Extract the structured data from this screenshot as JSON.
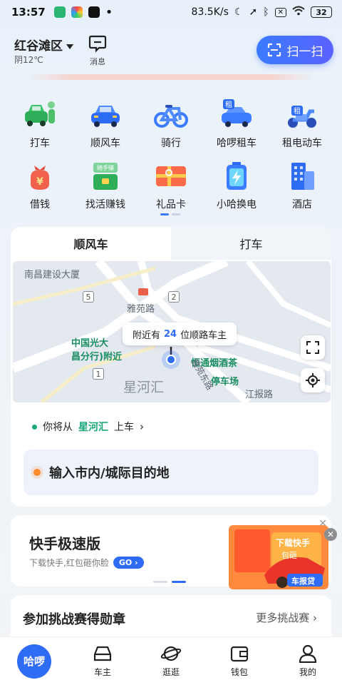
{
  "status_bar": {
    "time": "13:57",
    "net_speed": "83.5K/s",
    "battery": "32"
  },
  "header": {
    "location": "红谷滩区",
    "weather": "阴12℃",
    "message_label": "消息",
    "scan_label": "扫一扫"
  },
  "services_row1": [
    {
      "label": "打车",
      "icon": "taxi-car-icon"
    },
    {
      "label": "顺风车",
      "icon": "carpool-car-icon"
    },
    {
      "label": "骑行",
      "icon": "bike-icon"
    },
    {
      "label": "哈啰租车",
      "icon": "rental-car-icon"
    },
    {
      "label": "租电动车",
      "icon": "ebike-rental-icon"
    }
  ],
  "services_row2": [
    {
      "label": "借钱",
      "icon": "money-bag-icon"
    },
    {
      "label": "找活赚钱",
      "icon": "job-bag-icon"
    },
    {
      "label": "礼品卡",
      "icon": "gift-card-icon"
    },
    {
      "label": "小哈换电",
      "icon": "battery-swap-icon"
    },
    {
      "label": "酒店",
      "icon": "hotel-icon"
    }
  ],
  "ride_card": {
    "tabs": [
      "顺风车",
      "打车"
    ],
    "map": {
      "labels": {
        "building": "南昌建设大厦",
        "road1": "雅苑路",
        "bank": "中国光大",
        "bank2": "昌分行)附近",
        "shop": "恒通烟酒茶",
        "parking": "停车场",
        "area": "星河汇",
        "road2": "江报路",
        "road3": "雅苑东路"
      },
      "shields": [
        "5",
        "2",
        "1"
      ],
      "nearby_prefix": "附近有",
      "nearby_count": "24",
      "nearby_suffix": "位顺路车主"
    },
    "pickup_prefix": "你将从",
    "pickup_place": "星河汇",
    "pickup_suffix": "上车",
    "destination_placeholder": "输入市内/城际目的地"
  },
  "ad": {
    "title": "快手极速版",
    "subtitle": "下载快手,红包砸你脸",
    "go": "GO",
    "image_text1": "下载快手",
    "image_text2": "包砸",
    "image_badge": "车报贷"
  },
  "challenge": {
    "title": "参加挑战赛得勋章",
    "more": "更多挑战赛"
  },
  "bottom_nav": [
    {
      "label": "哈啰",
      "icon": "hellobike-logo"
    },
    {
      "label": "车主",
      "icon": "car-icon"
    },
    {
      "label": "逛逛",
      "icon": "planet-icon"
    },
    {
      "label": "钱包",
      "icon": "wallet-icon"
    },
    {
      "label": "我的",
      "icon": "person-icon"
    }
  ]
}
